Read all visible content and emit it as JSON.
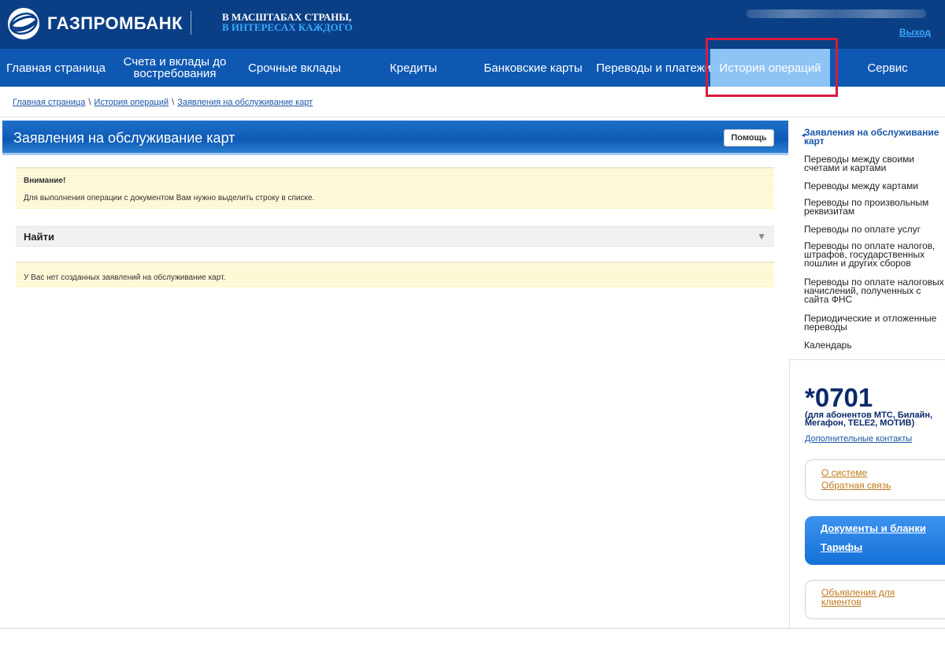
{
  "header": {
    "brand": "ГАЗПРОМБАНК",
    "slogan_line1": "В МАСШТАБАХ СТРАНЫ,",
    "slogan_line2": "В ИНТЕРЕСАХ КАЖДОГО",
    "logout": "Выход",
    "colors": {
      "bg": "#0a3f86",
      "accent": "#3ba7ff"
    }
  },
  "nav": {
    "items": [
      {
        "label": "Главная страница"
      },
      {
        "label": "Счета и вклады до востребования"
      },
      {
        "label": "Срочные вклады"
      },
      {
        "label": "Кредиты"
      },
      {
        "label": "Банковские карты"
      },
      {
        "label": "Переводы и платежи"
      },
      {
        "label": "История операций",
        "active": true
      },
      {
        "label": "Сервис"
      }
    ],
    "colors": {
      "bg": "#0e58b2",
      "active_bg": "#8ec3f5",
      "highlight": "#d81a3d"
    }
  },
  "breadcrumb": [
    "Главная страница",
    "История операций",
    "Заявления на обслуживание карт"
  ],
  "main": {
    "title": "Заявления на обслуживание карт",
    "help_label": "Помощь",
    "notice_title": "Внимание!",
    "notice_text": "Для выполнения операции с документом Вам нужно выделить строку в списке.",
    "find_label": "Найти",
    "find_toggle_icon": "triangle-down-icon",
    "empty_text": "У Вас нет созданных заявлений на обслуживание карт."
  },
  "sidebar": {
    "items": [
      {
        "label": "Заявления на обслуживание карт",
        "active": true
      },
      {
        "label": "Переводы между своими счетами и картами"
      },
      {
        "label": "Переводы между картами"
      },
      {
        "label": "Переводы по произвольным реквизитам"
      },
      {
        "label": "Переводы по оплате услуг"
      },
      {
        "label": "Переводы по оплате налогов, штрафов, государственных пошлин и других сборов"
      },
      {
        "label": "Переводы по оплате налоговых начислений, полученных с сайта ФНС"
      },
      {
        "label": "Периодические и отложенные переводы"
      },
      {
        "label": "Календарь"
      }
    ],
    "phone": "*0701",
    "phone_note": "(для абонентов МТС, Билайн, Мегафон, TELE2, МОТИВ)",
    "contacts_link": "Дополнительные контакты",
    "about_link": "О системе",
    "feedback_link": "Обратная связь",
    "docs_link": "Документы и бланки",
    "tariffs_link": "Тарифы",
    "ads_link": "Объявления для клиентов"
  }
}
